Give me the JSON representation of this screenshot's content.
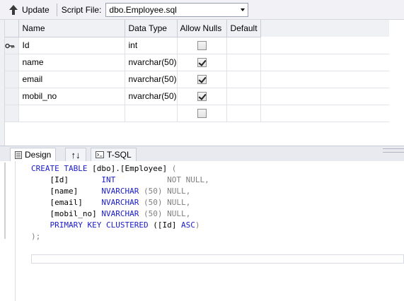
{
  "toolbar": {
    "update_label": "Update",
    "script_file_label": "Script File:",
    "script_file_value": "dbo.Employee.sql"
  },
  "grid": {
    "headers": [
      "Name",
      "Data Type",
      "Allow Nulls",
      "Default"
    ],
    "rows": [
      {
        "name": "Id",
        "type": "int",
        "allow_nulls": false,
        "primary_key": true
      },
      {
        "name": "name",
        "type": "nvarchar(50)",
        "allow_nulls": true,
        "primary_key": false
      },
      {
        "name": "email",
        "type": "nvarchar(50)",
        "allow_nulls": true,
        "primary_key": false
      },
      {
        "name": "mobil_no",
        "type": "nvarchar(50)",
        "allow_nulls": true,
        "primary_key": false
      },
      {
        "name": "",
        "type": "",
        "allow_nulls": false,
        "primary_key": false
      }
    ]
  },
  "tabs": {
    "design": "Design",
    "swap": "↑↓",
    "tsql": "T-SQL"
  },
  "sql": {
    "line1": {
      "kw": "CREATE TABLE",
      "name": " [dbo].[Employee] ",
      "paren": "("
    },
    "columns": [
      {
        "col": "[Id]",
        "type": "INT",
        "size": "",
        "null": "NOT NULL,"
      },
      {
        "col": "[name]",
        "type": "NVARCHAR",
        "size": "(50)",
        "null": "NULL,"
      },
      {
        "col": "[email]",
        "type": "NVARCHAR",
        "size": "(50)",
        "null": "NULL,"
      },
      {
        "col": "[mobil_no]",
        "type": "NVARCHAR",
        "size": "(50)",
        "null": "NULL,"
      }
    ],
    "pk": {
      "kw": "PRIMARY KEY CLUSTERED",
      "col": "([Id] ",
      "dir": "ASC",
      "close": ")"
    },
    "end": ");"
  },
  "colors": {
    "keyword": "#1a1acc",
    "gray": "#808080"
  }
}
